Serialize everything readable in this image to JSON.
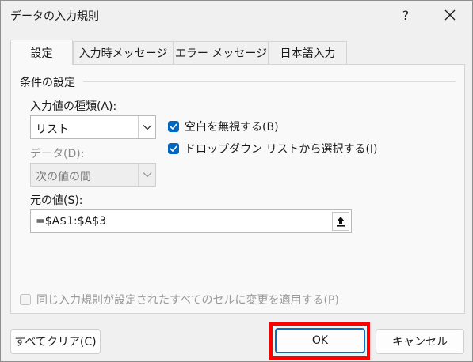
{
  "window": {
    "title": "データの入力規則",
    "help_glyph": "?"
  },
  "tabs": [
    {
      "label": "設定",
      "active": true
    },
    {
      "label": "入力時メッセージ",
      "active": false
    },
    {
      "label": "エラー メッセージ",
      "active": false
    },
    {
      "label": "日本語入力",
      "active": false
    }
  ],
  "settings": {
    "section_label": "条件の設定",
    "allow_label": "入力値の種類(A):",
    "allow_value": "リスト",
    "data_label": "データ(D):",
    "data_value": "次の値の間",
    "ignore_blank_label": "空白を無視する(B)",
    "ignore_blank_checked": true,
    "dropdown_label": "ドロップダウン リストから選択する(I)",
    "dropdown_checked": true,
    "source_label": "元の値(S):",
    "source_value": "=$A$1:$A$3",
    "apply_all_label": "同じ入力規則が設定されたすべてのセルに変更を適用する(P)",
    "apply_all_checked": false
  },
  "buttons": {
    "clear_all": "すべてクリア(C)",
    "ok": "OK",
    "cancel": "キャンセル"
  },
  "colors": {
    "accent": "#0067c0",
    "highlight": "#ff0000"
  },
  "icons": [
    "close-icon",
    "chevron-down-icon",
    "collapse-dialog-icon",
    "checkmark-icon"
  ]
}
